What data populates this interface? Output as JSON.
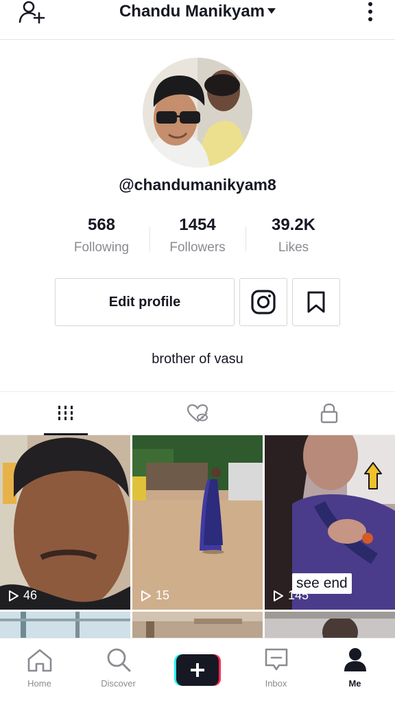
{
  "header": {
    "title": "Chandu Manikyam",
    "add_user_icon": "add-user-icon",
    "more_icon": "vertical-dots-icon"
  },
  "profile": {
    "handle": "@chandumanikyam8",
    "bio": "brother of vasu"
  },
  "stats": [
    {
      "value": "568",
      "label": "Following"
    },
    {
      "value": "1454",
      "label": "Followers"
    },
    {
      "value": "39.2K",
      "label": "Likes"
    }
  ],
  "actions": {
    "edit_profile": "Edit profile",
    "instagram_icon": "instagram-icon",
    "bookmark_icon": "bookmark-icon"
  },
  "tabs": [
    {
      "icon": "grid-icon",
      "active": true
    },
    {
      "icon": "liked-hidden-icon",
      "active": false
    },
    {
      "icon": "lock-icon",
      "active": false
    }
  ],
  "videos": [
    {
      "views": "46"
    },
    {
      "views": "15"
    },
    {
      "views": "145",
      "overlay_text": "see end"
    }
  ],
  "bottom_nav": [
    {
      "label": "Home",
      "icon": "home-icon"
    },
    {
      "label": "Discover",
      "icon": "search-icon"
    },
    {
      "label": "",
      "icon": "plus-icon"
    },
    {
      "label": "Inbox",
      "icon": "inbox-icon"
    },
    {
      "label": "Me",
      "icon": "person-icon",
      "active": true
    }
  ],
  "colors": {
    "accent_cyan": "#25f4ee",
    "accent_pink": "#fe2c55",
    "text": "#161823",
    "muted": "#8a8b91"
  }
}
